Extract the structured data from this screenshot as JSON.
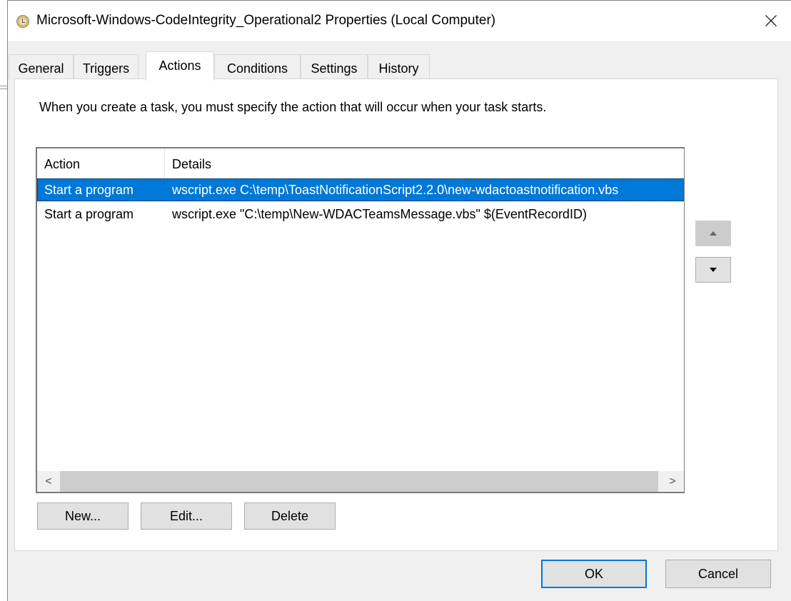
{
  "window": {
    "title": "Microsoft-Windows-CodeIntegrity_Operational2 Properties (Local Computer)",
    "icon": "clock-icon",
    "close_icon": "close-icon"
  },
  "tabs": [
    {
      "label": "General",
      "active": false
    },
    {
      "label": "Triggers",
      "active": false
    },
    {
      "label": "Actions",
      "active": true
    },
    {
      "label": "Conditions",
      "active": false
    },
    {
      "label": "Settings",
      "active": false
    },
    {
      "label": "History",
      "active": false
    }
  ],
  "actions_panel": {
    "description": "When you create a task, you must specify the action that will occur when your task starts.",
    "columns": [
      "Action",
      "Details"
    ],
    "rows": [
      {
        "action": "Start a program",
        "details": "wscript.exe C:\\temp\\ToastNotificationScript2.2.0\\new-wdactoastnotification.vbs",
        "selected": true
      },
      {
        "action": "Start a program",
        "details": "wscript.exe \"C:\\temp\\New-WDACTeamsMessage.vbs\" $(EventRecordID)",
        "selected": false
      }
    ],
    "scroll_left_glyph": "<",
    "scroll_right_glyph": ">",
    "move_up_icon": "triangle-up-icon",
    "move_down_icon": "triangle-down-icon",
    "buttons": {
      "new": "New...",
      "edit": "Edit...",
      "delete": "Delete"
    }
  },
  "footer": {
    "ok": "OK",
    "cancel": "Cancel"
  },
  "colors": {
    "selection": "#0078d7",
    "default_button_border": "#0078d7"
  }
}
